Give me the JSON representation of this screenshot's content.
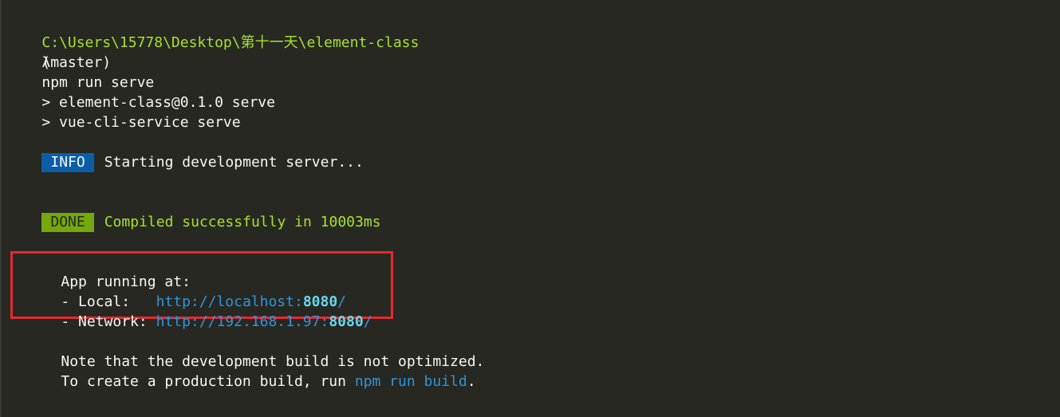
{
  "prompt": {
    "path": "C:\\Users\\15778\\Desktop\\第十一天\\element-class",
    "branch": "(master)",
    "symbol": "λ",
    "command": "npm run serve"
  },
  "script_output": {
    "line1": "> element-class@0.1.0 serve",
    "line2": "> vue-cli-service serve"
  },
  "info": {
    "badge": "INFO",
    "message": "Starting development server..."
  },
  "done": {
    "badge": "DONE",
    "message": "Compiled successfully in 10003ms"
  },
  "app": {
    "heading": "App running at:",
    "local_label": "- Local:   ",
    "local_url_prefix": "http://localhost:",
    "local_port": "8080",
    "local_url_suffix": "/",
    "network_label": "- Network: ",
    "network_url_prefix": "http://192.168.1.97:",
    "network_port": "8080",
    "network_url_suffix": "/"
  },
  "note": {
    "line1": "Note that the development build is not optimized.",
    "line2_prefix": "To create a production build, run ",
    "line2_command": "npm run build",
    "line2_suffix": "."
  },
  "colors": {
    "background": "#272822",
    "prompt_green": "#a6e22e",
    "info_blue": "#0a5ea8",
    "done_green": "#74a80c",
    "link_blue": "#2f95dc",
    "highlight_red": "#e8282e"
  }
}
